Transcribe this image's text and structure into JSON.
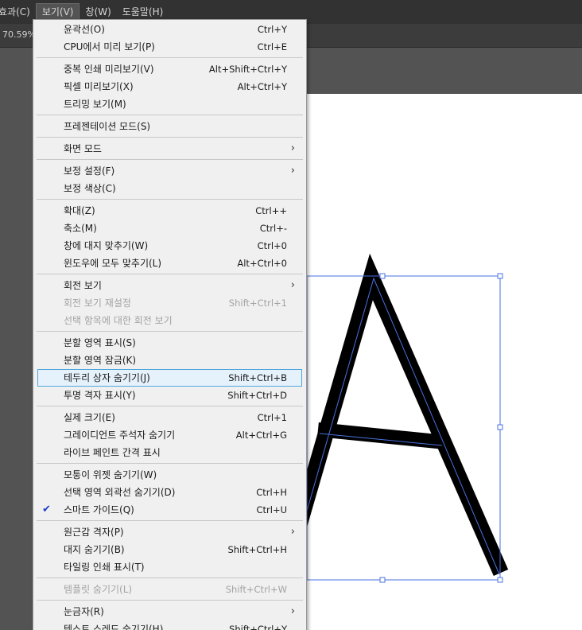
{
  "menubar": {
    "items": [
      "효과(C)",
      "보기(V)",
      "창(W)",
      "도움말(H)"
    ],
    "active_index": 1
  },
  "document": {
    "zoom": "70.59%"
  },
  "menu": {
    "groups": [
      [
        {
          "label": "윤곽선(O)",
          "shortcut": "Ctrl+Y"
        },
        {
          "label": "CPU에서 미리 보기(P)",
          "shortcut": "Ctrl+E"
        }
      ],
      [
        {
          "label": "중복 인쇄 미리보기(V)",
          "shortcut": "Alt+Shift+Ctrl+Y"
        },
        {
          "label": "픽셀 미리보기(X)",
          "shortcut": "Alt+Ctrl+Y"
        },
        {
          "label": "트리밍 보기(M)",
          "shortcut": ""
        }
      ],
      [
        {
          "label": "프레젠테이션 모드(S)",
          "shortcut": ""
        }
      ],
      [
        {
          "label": "화면 모드",
          "shortcut": "",
          "submenu": true
        }
      ],
      [
        {
          "label": "보정 설정(F)",
          "shortcut": "",
          "submenu": true
        },
        {
          "label": "보정 색상(C)",
          "shortcut": ""
        }
      ],
      [
        {
          "label": "확대(Z)",
          "shortcut": "Ctrl++"
        },
        {
          "label": "축소(M)",
          "shortcut": "Ctrl+-"
        },
        {
          "label": "창에 대지 맞추기(W)",
          "shortcut": "Ctrl+0"
        },
        {
          "label": "윈도우에 모두 맞추기(L)",
          "shortcut": "Alt+Ctrl+0"
        }
      ],
      [
        {
          "label": "회전 보기",
          "shortcut": "",
          "submenu": true
        },
        {
          "label": "회전 보기 재설정",
          "shortcut": "Shift+Ctrl+1",
          "disabled": true
        },
        {
          "label": "선택 항목에 대한 회전 보기",
          "shortcut": "",
          "disabled": true
        }
      ],
      [
        {
          "label": "분할 영역 표시(S)",
          "shortcut": ""
        },
        {
          "label": "분할 영역 잠금(K)",
          "shortcut": ""
        },
        {
          "label": "테두리 상자 숨기기(J)",
          "shortcut": "Shift+Ctrl+B",
          "highlight": true
        },
        {
          "label": "투명 격자 표시(Y)",
          "shortcut": "Shift+Ctrl+D"
        }
      ],
      [
        {
          "label": "실제 크기(E)",
          "shortcut": "Ctrl+1"
        },
        {
          "label": "그레이디언트 주석자 숨기기",
          "shortcut": "Alt+Ctrl+G"
        },
        {
          "label": "라이브 페인트 간격 표시",
          "shortcut": ""
        }
      ],
      [
        {
          "label": "모퉁이 위젯 숨기기(W)",
          "shortcut": ""
        },
        {
          "label": "선택 영역 외곽선  숨기기(D)",
          "shortcut": "Ctrl+H"
        },
        {
          "label": "스마트 가이드(Q)",
          "shortcut": "Ctrl+U",
          "checked": true
        }
      ],
      [
        {
          "label": "원근감 격자(P)",
          "shortcut": "",
          "submenu": true
        },
        {
          "label": "대지 숨기기(B)",
          "shortcut": "Shift+Ctrl+H"
        },
        {
          "label": "타일링 인쇄 표시(T)",
          "shortcut": ""
        }
      ],
      [
        {
          "label": "템플릿 숨기기(L)",
          "shortcut": "Shift+Ctrl+W",
          "disabled": true
        }
      ],
      [
        {
          "label": "눈금자(R)",
          "shortcut": "",
          "submenu": true
        },
        {
          "label": "텍스트 스레드 숨기기(H)",
          "shortcut": "Shift+Ctrl+Y"
        }
      ]
    ]
  },
  "icons": {
    "submenu_arrow": "chevron-right-icon",
    "check": "checkmark-icon"
  },
  "colors": {
    "selection_blue": "#4a72e0",
    "highlight_bg": "#e5f1fb",
    "highlight_border": "#4fa6db"
  }
}
